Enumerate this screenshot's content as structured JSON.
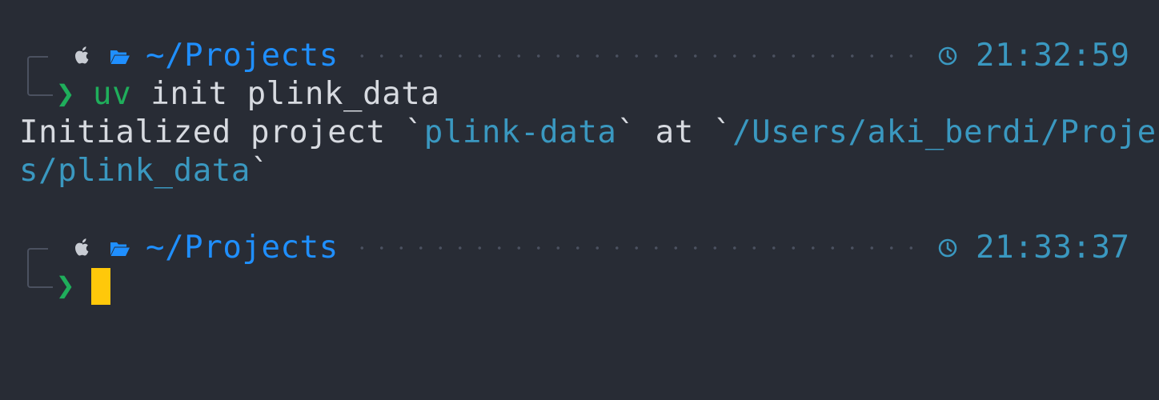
{
  "theme": {
    "background": "#282c35",
    "directory_color": "#1f8fff",
    "time_color": "#3a98c0",
    "prompt_color": "#1fae5b",
    "cursor_color": "#ffc80a",
    "highlight_color": "#3a98c0"
  },
  "prompts": [
    {
      "os_icon": "apple-icon",
      "dir_icon": "folder-open-icon",
      "directory": "~/Projects",
      "time_icon": "clock-icon",
      "time": "21:32:59",
      "prompt_symbol": "❯",
      "command_program": "uv",
      "command_args": " init plink_data"
    },
    {
      "os_icon": "apple-icon",
      "dir_icon": "folder-open-icon",
      "directory": "~/Projects",
      "time_icon": "clock-icon",
      "time": "21:33:37",
      "prompt_symbol": "❯",
      "command_program": "",
      "command_args": ""
    }
  ],
  "output": {
    "line1_prefix": "Initialized project `",
    "project_name": "plink-data",
    "line1_mid": "` at `",
    "path_part1": "/Users/aki_berdi/Project",
    "path_part2": "s/plink_data",
    "line2_suffix": "`"
  }
}
